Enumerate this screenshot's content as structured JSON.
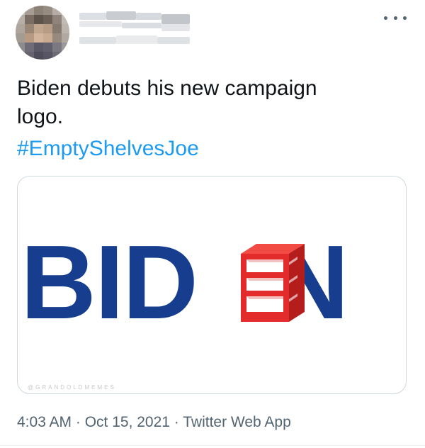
{
  "tweet": {
    "text_line1": "Biden debuts his new campaign",
    "text_line2": "logo.",
    "hashtag": "#EmptyShelvesJoe",
    "timestamp": "4:03 AM · Oct 15, 2021 · Twitter Web App"
  },
  "media": {
    "logo_letters": [
      "B",
      "I",
      "D",
      "N"
    ],
    "watermark": "@GRANDOLDMEMES",
    "logo_color": "#173d8f",
    "shelf_color": "#e32b2b"
  },
  "icons": {
    "more": "more-options-icon",
    "shelf": "shelf-icon"
  },
  "colors": {
    "link": "#1d9bf0",
    "muted": "#536471",
    "text": "#0f1419",
    "border": "#cfd9de"
  }
}
